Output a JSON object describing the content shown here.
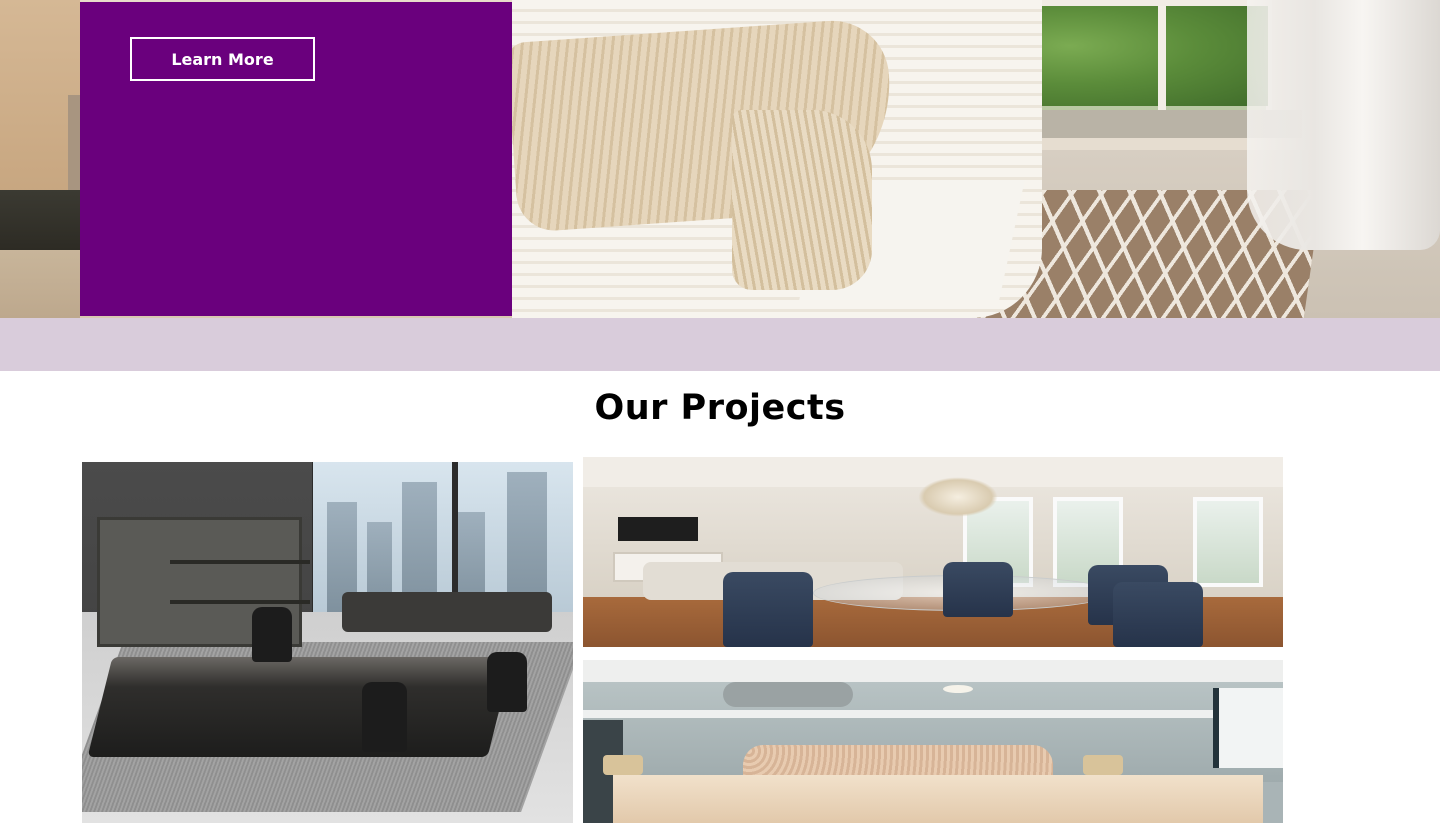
{
  "hero": {
    "cta_label": "Learn More",
    "panel_color": "#6a007d"
  },
  "band": {
    "color": "#d9ccdb"
  },
  "projects": {
    "title": "Our Projects",
    "items": [
      {
        "image_subject": "modern executive office with dark desk, cabinet and city-view windows"
      },
      {
        "image_subject": "open living and dining room with navy chairs and glass table"
      },
      {
        "image_subject": "bedroom with tufted headboard and ceiling fan"
      }
    ]
  }
}
